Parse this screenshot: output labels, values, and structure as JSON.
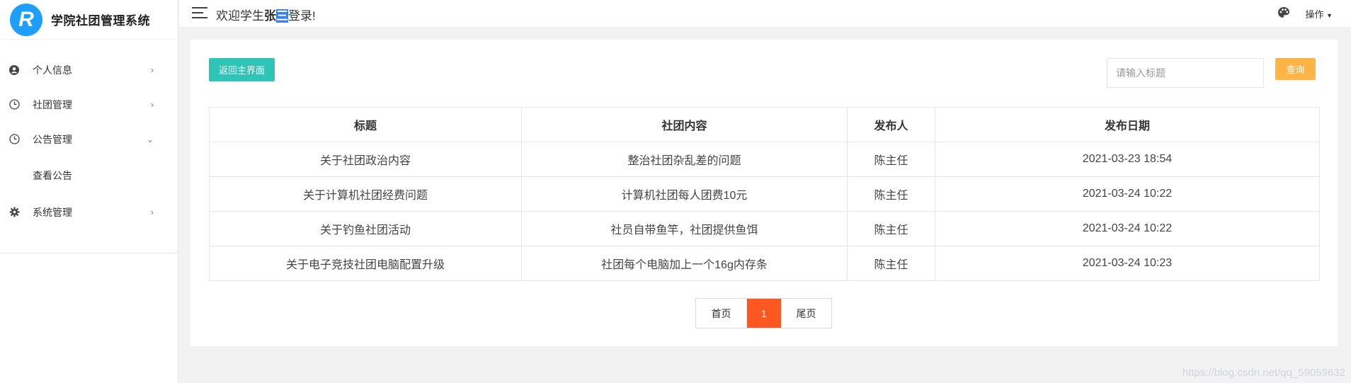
{
  "app": {
    "title": "学院社团管理系统",
    "logo_letter": "R",
    "brand_color": "#1e9fff"
  },
  "header": {
    "welcome_prefix": "欢迎学生",
    "user_name_first": "张",
    "user_name_selected": "三",
    "welcome_suffix": "登录!",
    "ops_label": "操作"
  },
  "sidebar": {
    "items": [
      {
        "label": "个人信息",
        "icon": "user-circle-icon",
        "arrow": "›"
      },
      {
        "label": "社团管理",
        "icon": "clock-icon",
        "arrow": "›"
      },
      {
        "label": "公告管理",
        "icon": "clock-icon",
        "arrow": "⌄"
      },
      {
        "label": "查看公告"
      },
      {
        "label": "系统管理",
        "icon": "gear-icon",
        "arrow": "›"
      }
    ]
  },
  "toolbar": {
    "back_label": "返回主界面",
    "search_placeholder": "请输入标题",
    "query_label": "查询"
  },
  "table": {
    "headers": [
      "标题",
      "社团内容",
      "发布人",
      "发布日期"
    ],
    "rows": [
      [
        "关于社团政治内容",
        "整治社团杂乱差的问题",
        "陈主任",
        "2021-03-23 18:54"
      ],
      [
        "关于计算机社团经费问题",
        "计算机社团每人团费10元",
        "陈主任",
        "2021-03-24 10:22"
      ],
      [
        "关于钓鱼社团活动",
        "社员自带鱼竿，社团提供鱼饵",
        "陈主任",
        "2021-03-24 10:22"
      ],
      [
        "关于电子竞技社团电脑配置升级",
        "社团每个电脑加上一个16g内存条",
        "陈主任",
        "2021-03-24 10:23"
      ]
    ]
  },
  "pagination": {
    "first": "首页",
    "current": "1",
    "last": "尾页",
    "active_color": "#ff5722"
  },
  "watermark": "https://blog.csdn.net/qq_59059632"
}
